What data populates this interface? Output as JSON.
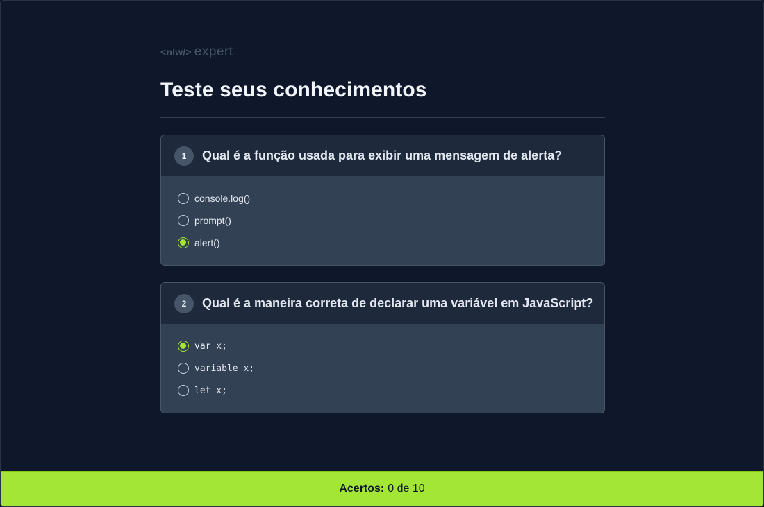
{
  "logo": {
    "tag": "<nlw/>",
    "word": "expert"
  },
  "page": {
    "title": "Teste seus conhecimentos"
  },
  "questions": [
    {
      "number": "1",
      "text": "Qual é a função usada para exibir uma mensagem de alerta?",
      "options": [
        {
          "label": "console.log()",
          "checked": false
        },
        {
          "label": "prompt()",
          "checked": false
        },
        {
          "label": "alert()",
          "checked": true
        }
      ]
    },
    {
      "number": "2",
      "text": "Qual é a maneira correta de declarar uma variável em JavaScript?",
      "options": [
        {
          "label": "var x;",
          "checked": true
        },
        {
          "label": "variable x;",
          "checked": false
        },
        {
          "label": "let x;",
          "checked": false
        }
      ]
    }
  ],
  "footer": {
    "label": "Acertos:",
    "value": "0 de 10"
  },
  "colors": {
    "background": "#0f172a",
    "card_header": "#1e293b",
    "card_body": "#334155",
    "accent": "#a3e635"
  }
}
